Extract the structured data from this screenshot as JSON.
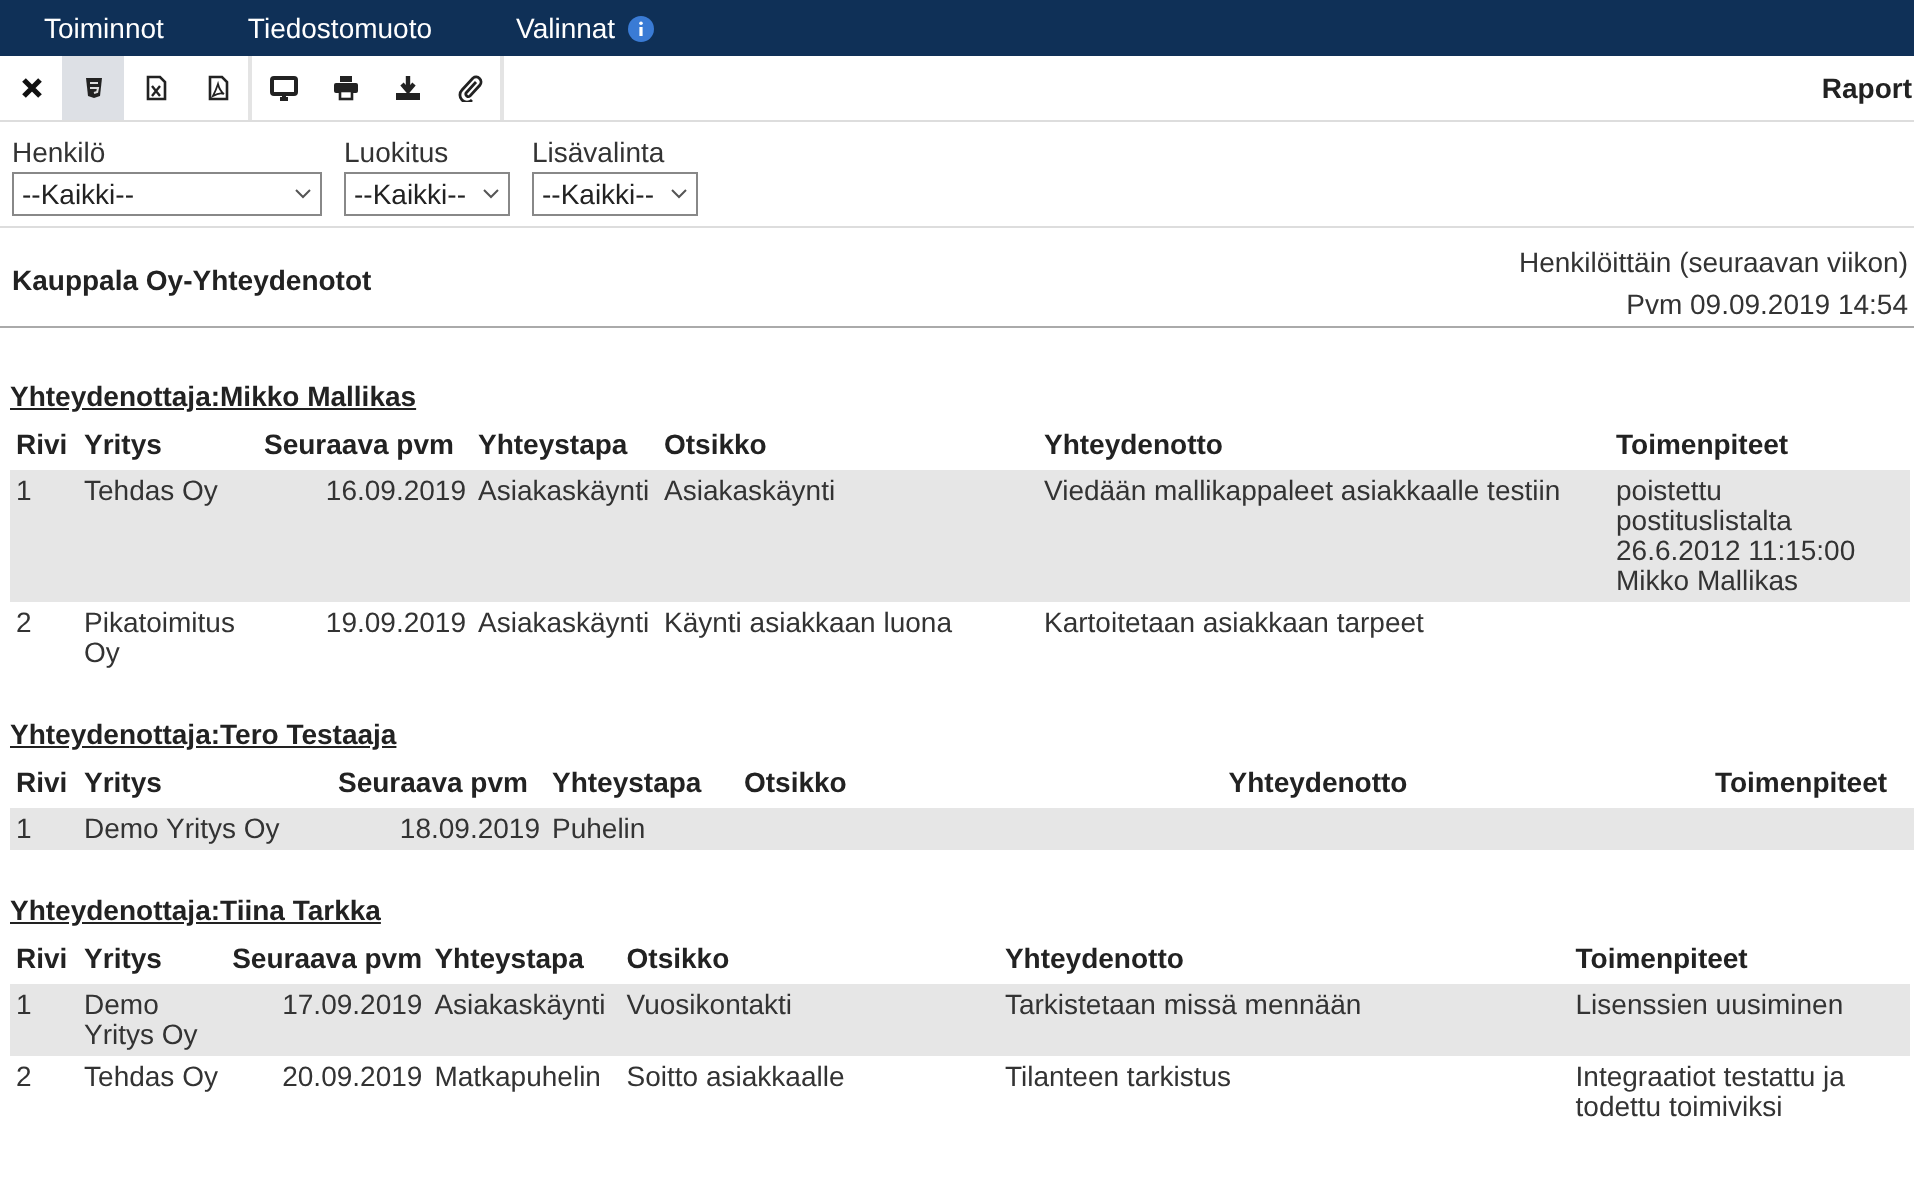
{
  "menu": [
    {
      "label": "Toiminnot",
      "info": false
    },
    {
      "label": "Tiedostomuoto",
      "info": false
    },
    {
      "label": "Valinnat",
      "info": true
    }
  ],
  "toolbar": {
    "groups": [
      [
        {
          "kind": "close",
          "selected": false
        },
        {
          "kind": "html",
          "selected": true
        },
        {
          "kind": "excel",
          "selected": false
        },
        {
          "kind": "pdf",
          "selected": false
        }
      ],
      [
        {
          "kind": "monitor",
          "selected": false
        },
        {
          "kind": "print",
          "selected": false
        },
        {
          "kind": "download",
          "selected": false
        },
        {
          "kind": "attach",
          "selected": false
        }
      ]
    ],
    "title": "Raport"
  },
  "filters": [
    {
      "label": "Henkilö",
      "value": "--Kaikki--"
    },
    {
      "label": "Luokitus",
      "value": "--Kaikki--"
    },
    {
      "label": "Lisävalinta",
      "value": "--Kaikki--"
    }
  ],
  "report": {
    "title": "Kauppala Oy-Yhteydenotot",
    "subtitle": "Henkilöittäin (seuraavan viikon)",
    "date": "Pvm 09.09.2019 14:54"
  },
  "groups": [
    {
      "heading": "Yhteydenottaja:Mikko Mallikas",
      "columns": [
        "Rivi",
        "Yritys",
        "Seuraava pvm",
        "Yhteystapa",
        "Otsikko",
        "Yhteydenotto",
        "Toimenpiteet"
      ],
      "rows": [
        [
          "1",
          "Tehdas Oy",
          "16.09.2019",
          "Asiakaskäynti",
          "Asiakaskäynti",
          "Viedään mallikappaleet asiakkaalle testiin",
          "poistettu postituslistalta 26.6.2012 11:15:00 Mikko Mallikas"
        ],
        [
          "2",
          "Pikatoimitus Oy",
          "19.09.2019",
          "Asiakaskäynti",
          "Käynti asiakkaan luona",
          "Kartoitetaan asiakkaan tarpeet",
          ""
        ]
      ]
    },
    {
      "heading": "Yhteydenottaja:Tero Testaaja",
      "columns": [
        "Rivi",
        "Yritys",
        "Seuraava pvm",
        "Yhteystapa",
        "Otsikko",
        "Yhteydenotto",
        "Toimenpiteet"
      ],
      "rows": [
        [
          "1",
          "Demo Yritys Oy",
          "18.09.2019",
          "Puhelin",
          "",
          "",
          ""
        ]
      ]
    },
    {
      "heading": "Yhteydenottaja:Tiina Tarkka",
      "columns": [
        "Rivi",
        "Yritys",
        "Seuraava pvm",
        "Yhteystapa",
        "Otsikko",
        "Yhteydenotto",
        "Toimenpiteet"
      ],
      "rows": [
        [
          "1",
          "Demo Yritys Oy",
          "17.09.2019",
          "Asiakaskäynti",
          "Vuosikontakti",
          "Tarkistetaan missä mennään",
          "Lisenssien uusiminen"
        ],
        [
          "2",
          "Tehdas Oy",
          "20.09.2019",
          "Matkapuhelin",
          "Soitto asiakkaalle",
          "Tilanteen tarkistus",
          "Integraatiot testattu ja todettu toimiviksi"
        ]
      ]
    }
  ]
}
